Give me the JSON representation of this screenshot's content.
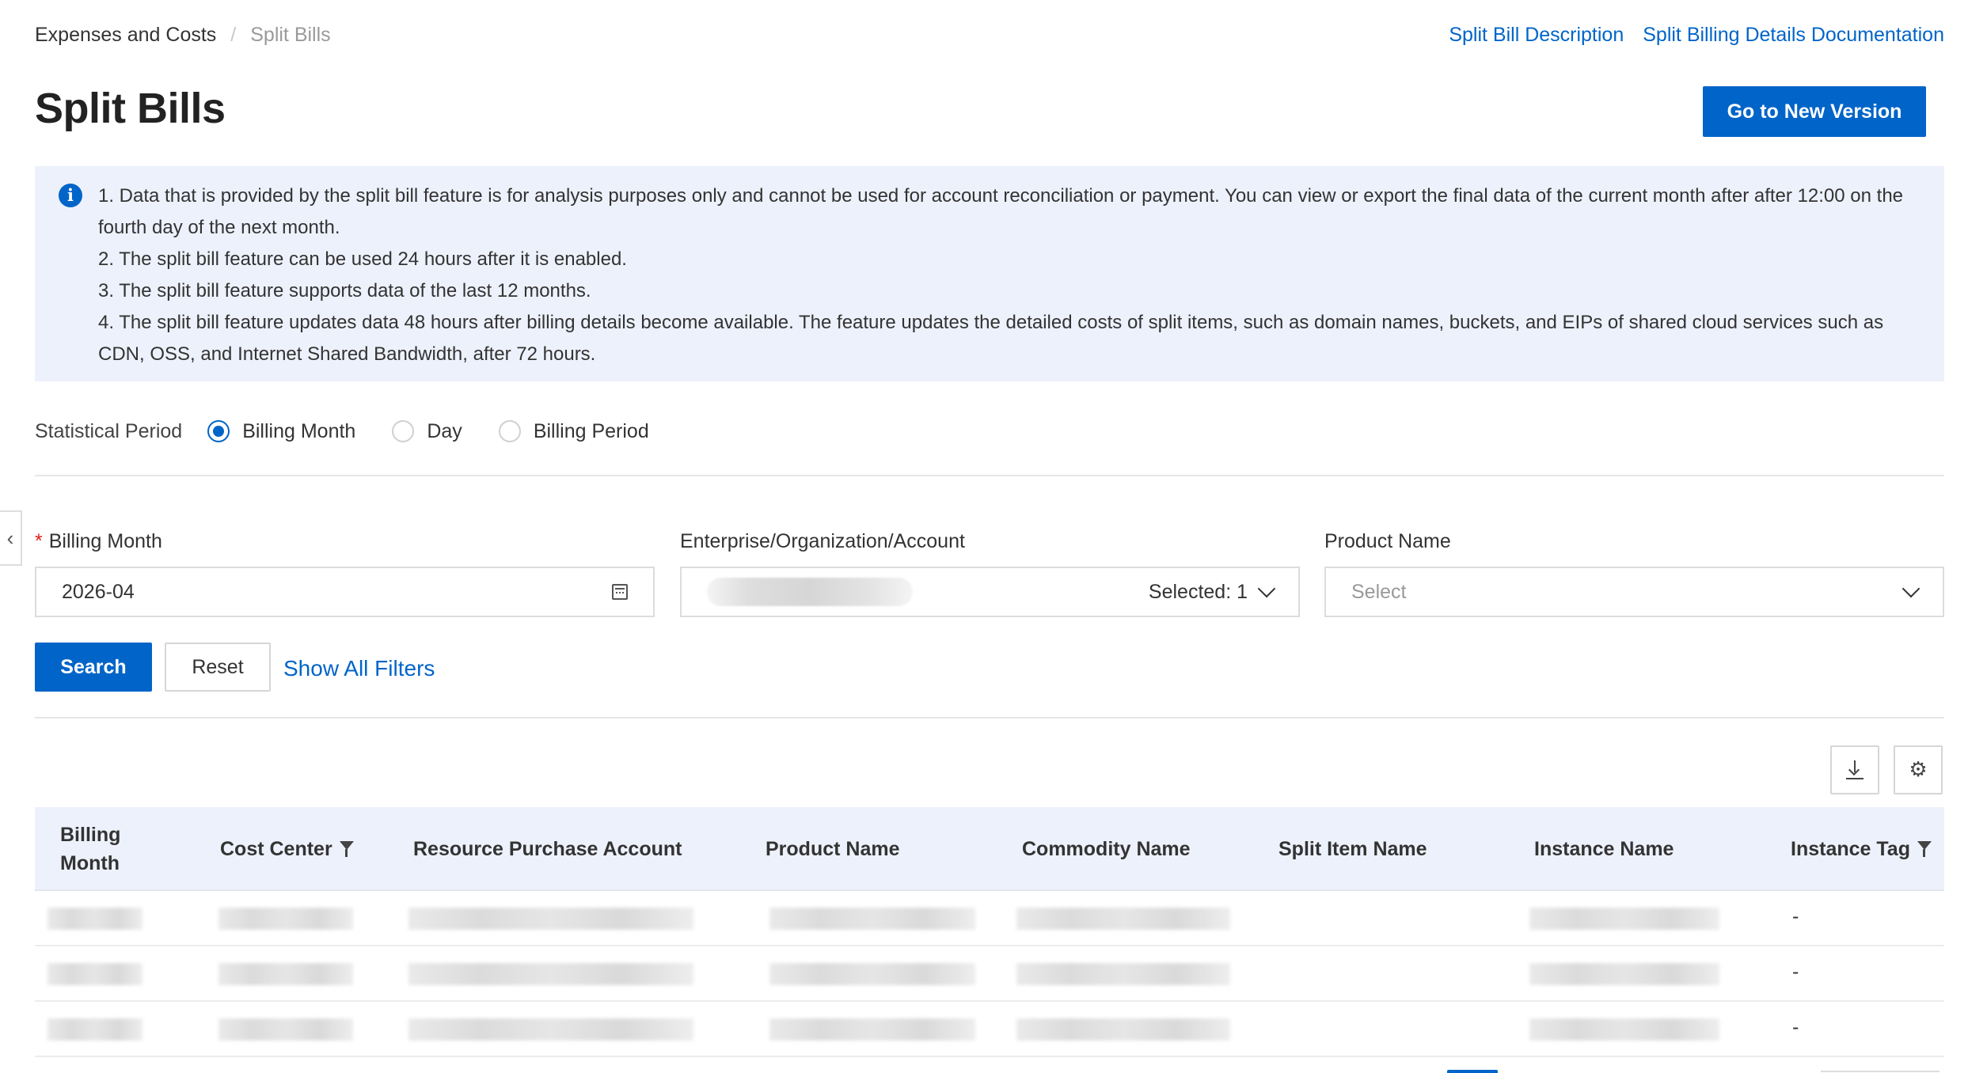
{
  "breadcrumb": {
    "parent": "Expenses and Costs",
    "separator": "/",
    "current": "Split Bills"
  },
  "top_links": {
    "description": "Split Bill Description",
    "documentation": "Split Billing Details Documentation"
  },
  "page_title": "Split Bills",
  "new_version_label": "Go to New Version",
  "notice": {
    "icon": "info-icon",
    "items": [
      "1. Data that is provided by the split bill feature is for analysis purposes only and cannot be used for account reconciliation or payment. You can view or export the final data of the current month after after 12:00 on the fourth day of the next month.",
      "2. The split bill feature can be used 24 hours after it is enabled.",
      "3. The split bill feature supports data of the last 12 months.",
      "4. The split bill feature updates data 48 hours after billing details become available. The feature updates the detailed costs of split items, such as domain names, buckets, and EIPs of shared cloud services such as CDN, OSS, and Internet Shared Bandwidth, after 72 hours."
    ]
  },
  "statistical_period": {
    "label": "Statistical Period",
    "options": [
      {
        "label": "Billing Month",
        "checked": true
      },
      {
        "label": "Day",
        "checked": false
      },
      {
        "label": "Billing Period",
        "checked": false
      }
    ]
  },
  "filters": {
    "billing_month": {
      "label": "Billing Month",
      "required_mark": "*",
      "value": "2026-04"
    },
    "account": {
      "label": "Enterprise/Organization/Account",
      "selected_text": "Selected: 1"
    },
    "product": {
      "label": "Product Name",
      "placeholder": "Select"
    }
  },
  "actions": {
    "search": "Search",
    "reset": "Reset",
    "show_filters": "Show All Filters"
  },
  "table": {
    "columns": [
      {
        "label": "Billing\nMonth",
        "filter": false
      },
      {
        "label": "Cost Center",
        "filter": true
      },
      {
        "label": "Resource Purchase Account",
        "filter": false
      },
      {
        "label": "Product Name",
        "filter": false
      },
      {
        "label": "Commodity Name",
        "filter": false
      },
      {
        "label": "Split Item Name",
        "filter": false
      },
      {
        "label": "Instance Name",
        "filter": false
      },
      {
        "label": "Instance Tag",
        "filter": true
      }
    ],
    "rows": [
      {
        "instance_tag": "-"
      },
      {
        "instance_tag": "-"
      },
      {
        "instance_tag": "-"
      }
    ]
  },
  "colors": {
    "primary": "#0064c8",
    "notice_bg": "#edf1fb",
    "required": "#e02020"
  }
}
